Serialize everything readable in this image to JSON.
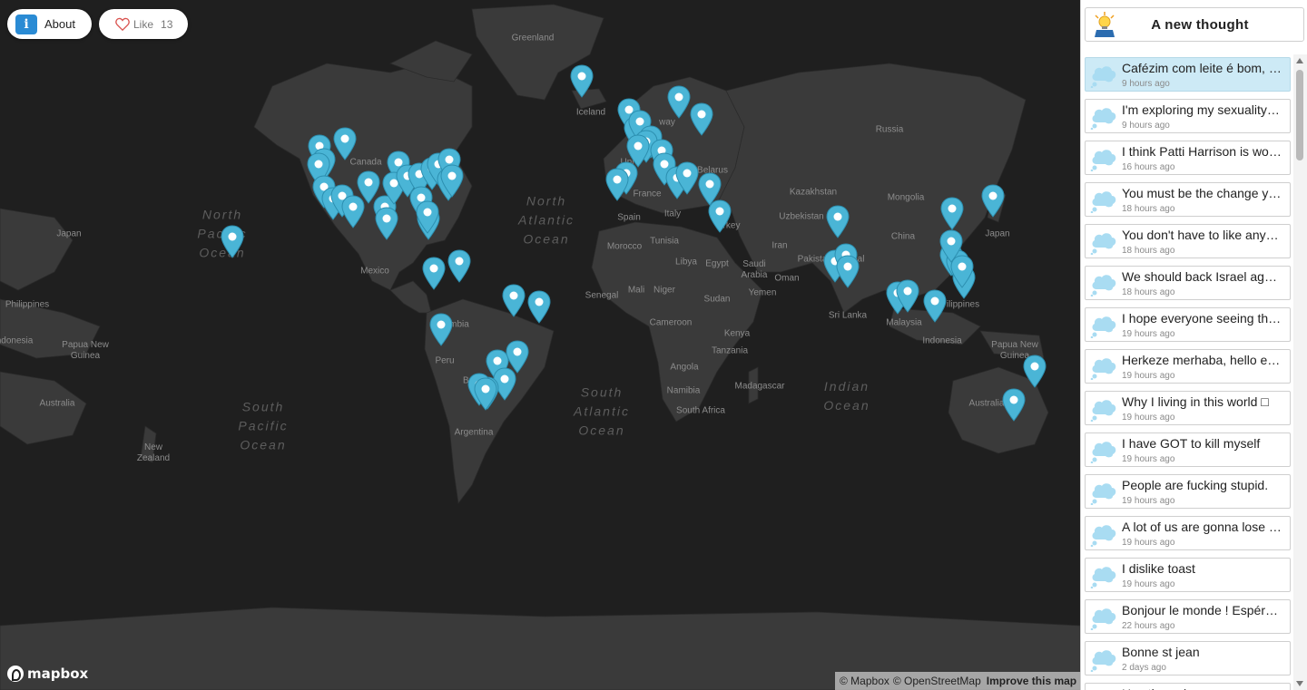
{
  "header": {
    "about_label": "About",
    "like_label": "Like",
    "like_count": "13",
    "new_thought_label": "A new thought"
  },
  "map": {
    "provider_logo": "mapbox",
    "attribution": {
      "mapbox": "© Mapbox",
      "osm": "© OpenStreetMap",
      "improve": "Improve this map"
    },
    "place_labels": {
      "greenland": "Greenland",
      "iceland": "Iceland",
      "canada": "Canada",
      "russia": "Russia",
      "norway": "way",
      "belarus": "Belarus",
      "kazakhstan": "Kazakhstan",
      "mongolia": "Mongolia",
      "china": "China",
      "japan_east": "Japan",
      "japan_west": "Japan",
      "uzbekistan": "Uzbekistan",
      "iran": "Iran",
      "pakistan": "Pakista",
      "nepal": "epal",
      "turkey": "rkey",
      "france": "France",
      "spain": "Spain",
      "italy": "Italy",
      "uk": "Uni",
      "morocco": "Morocco",
      "tunisia": "Tunisia",
      "libya": "Libya",
      "egypt": "Egypt",
      "saudi": "Saudi\nArabia",
      "oman": "Oman",
      "yemen": "Yemen",
      "sudan": "Sudan",
      "mali": "Mali",
      "niger": "Niger",
      "senegal": "Senegal",
      "cameroon": "Cameroon",
      "kenya": "Kenya",
      "tanzania": "Tanzania",
      "angola": "Angola",
      "namibia": "Namibia",
      "south_africa": "South Africa",
      "madagascar": "Madagascar",
      "sri_lanka": "Sri Lanka",
      "malaysia": "Malaysia",
      "indonesia_east": "Indonesia",
      "indonesia_west": "ndonesia",
      "philippines_east": "ilippines",
      "philippines_west": "Philippines",
      "papua_east": "Papua New\nGuinea",
      "papua_west": "Papua New\nGuinea",
      "australia_west": "Australia",
      "australia_east": "Australia",
      "new_zealand": "New\nZealand",
      "mexico": "Mexico",
      "colombia": "mbia",
      "peru": "Peru",
      "bolivia": "Bolivi",
      "argentina": "Argentina"
    },
    "ocean_labels": {
      "north_pacific": "North\nPacific\nOcean",
      "north_atlantic": "North\nAtlantic\nOcean",
      "south_pacific": "South\nPacific\nOcean",
      "south_atlantic": "South\nAtlantic\nOcean",
      "indian": "Indian\nOcean"
    },
    "marker_color": "#4ab5d6",
    "marker_count": 68
  },
  "feed": {
    "items": [
      {
        "text": "Cafézim com leite é bom, …",
        "time": "9 hours ago",
        "active": true
      },
      {
        "text": "I'm exploring my sexuality…",
        "time": "9 hours ago"
      },
      {
        "text": "I think Patti Harrison is wo…",
        "time": "16 hours ago"
      },
      {
        "text": "You must be the change y…",
        "time": "18 hours ago"
      },
      {
        "text": "You don't have to like any…",
        "time": "18 hours ago"
      },
      {
        "text": "We should back Israel ag…",
        "time": "18 hours ago"
      },
      {
        "text": "I hope everyone seeing th…",
        "time": "19 hours ago"
      },
      {
        "text": "Herkeze merhaba, hello e…",
        "time": "19 hours ago"
      },
      {
        "text": "Why I living in this world □",
        "time": "19 hours ago"
      },
      {
        "text": "I have GOT to kill myself",
        "time": "19 hours ago"
      },
      {
        "text": "People are fucking stupid.",
        "time": "19 hours ago"
      },
      {
        "text": "A lot of us are gonna lose …",
        "time": "19 hours ago"
      },
      {
        "text": "I dislike toast",
        "time": "19 hours ago"
      },
      {
        "text": "Bonjour le monde ! Espér…",
        "time": "22 hours ago"
      },
      {
        "text": "Bonne st jean",
        "time": "2 days ago"
      },
      {
        "text": "Hey there :)",
        "time": ""
      }
    ]
  },
  "colors": {
    "map_background": "#1f1f1f",
    "land": "#3a3a3a",
    "active_item": "#cdeaf6",
    "about_icon": "#2a8bd4"
  }
}
